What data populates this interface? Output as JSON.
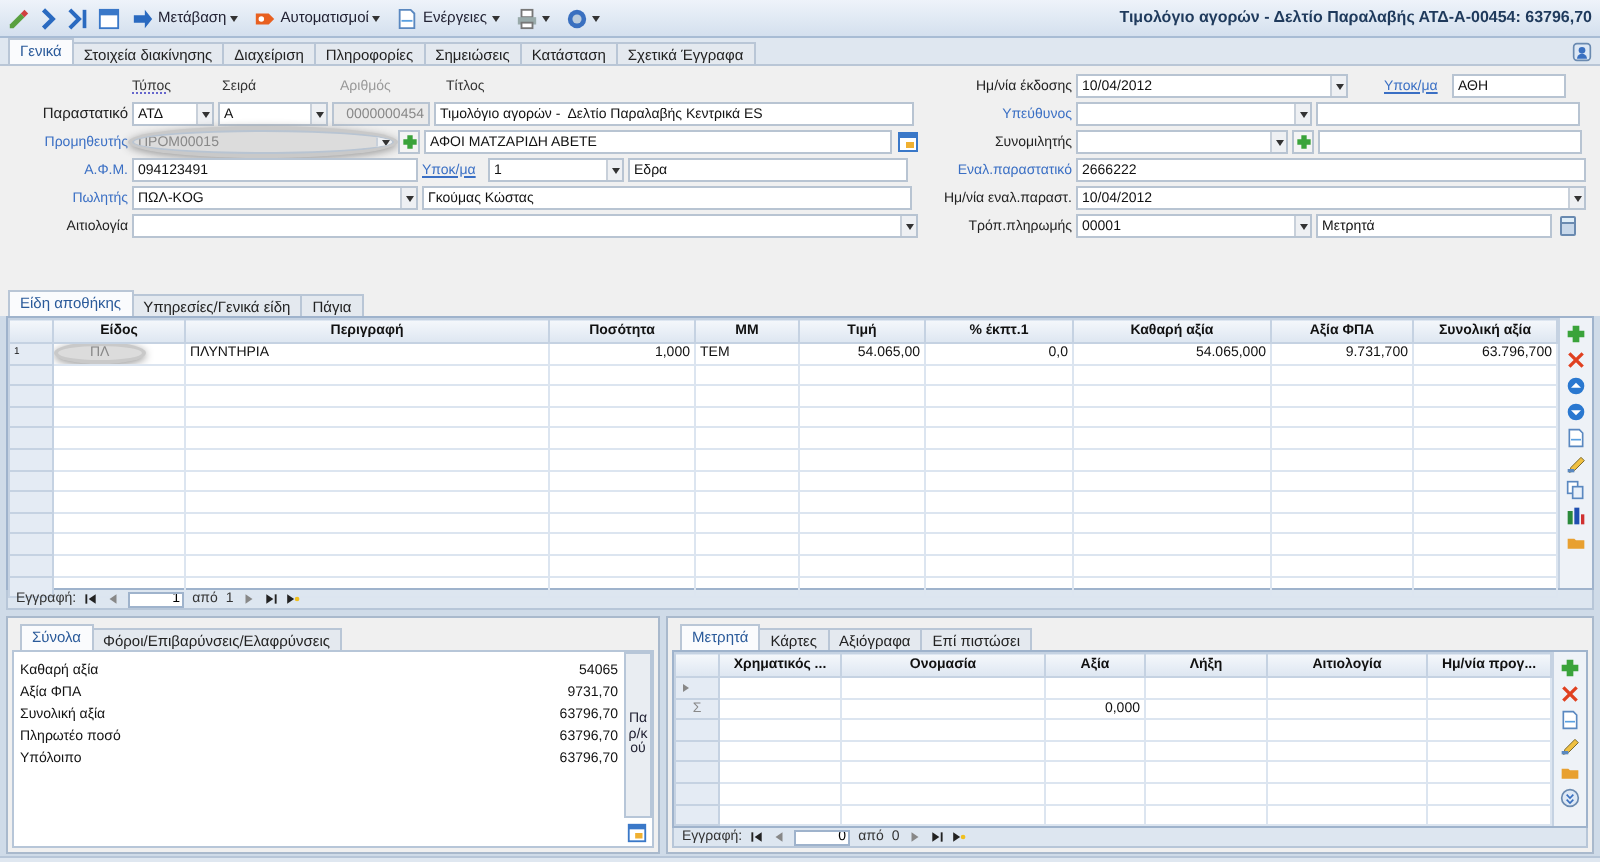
{
  "toolbar": {
    "menus": [
      {
        "label": "Μετάβαση"
      },
      {
        "label": "Αυτοματισμοί"
      },
      {
        "label": "Ενέργειες"
      }
    ],
    "title": "Τιμολόγιο αγορών -  Δελτίο Παραλαβής ΑΤΔ-Α-00454: 63796,70"
  },
  "tabs": [
    {
      "label": "Γενικά",
      "selected": true
    },
    {
      "label": "Στοιχεία διακίνησης",
      "selected": false
    },
    {
      "label": "Διαχείριση",
      "selected": false
    },
    {
      "label": "Πληροφορίες",
      "selected": false
    },
    {
      "label": "Σημειώσεις",
      "selected": false
    },
    {
      "label": "Κατάσταση",
      "selected": false
    },
    {
      "label": "Σχετικά Έγγραφα",
      "selected": false
    }
  ],
  "header_labels": [
    {
      "text": "Τύπος",
      "disabled": false
    },
    {
      "text": "Σειρά",
      "disabled": false
    },
    {
      "text": "Αριθμός",
      "disabled": true
    },
    {
      "text": "Τίτλος",
      "disabled": false
    }
  ],
  "left_rows": [
    {
      "label": "Παραστατικό",
      "link": false,
      "controls": [
        {
          "kind": "combo",
          "value": "ΑΤΔ"
        },
        {
          "kind": "combo",
          "value": "Α"
        },
        {
          "kind": "field",
          "value": "0000000454",
          "disabled": true
        },
        {
          "kind": "field",
          "value": "Τιμολόγιο αγορών -  Δελτίο Παραλαβής Κεντρικά ES"
        }
      ]
    },
    {
      "label": "Προμηθευτής",
      "link": true,
      "controls": [
        {
          "kind": "combo",
          "value": "ΠΡΟΜ00015",
          "highlighted": true
        },
        {
          "kind": "add"
        },
        {
          "kind": "field",
          "value": "ΑΦΟΙ ΜΑΤΖΑΡΙΔΗ ΑΒΕΤΕ"
        },
        {
          "kind": "calendar"
        }
      ]
    },
    {
      "label": "Α.Φ.Μ.",
      "link": true,
      "controls": [
        {
          "kind": "field",
          "value": "094123491"
        },
        {
          "kind": "link",
          "text": "Υποκ/μα"
        },
        {
          "kind": "combo",
          "value": "1"
        },
        {
          "kind": "field",
          "value": "Εδρα"
        }
      ]
    },
    {
      "label": "Πωλητής",
      "link": true,
      "controls": [
        {
          "kind": "combo",
          "value": "ΠΩΛ-KOG"
        },
        {
          "kind": "field",
          "value": "Γκούμας Κώστας"
        }
      ]
    },
    {
      "label": "Αιτιολογία",
      "link": false,
      "controls": [
        {
          "kind": "combo"
        }
      ]
    }
  ],
  "right_rows": [
    {
      "label": "Ημ/νία έκδοσης",
      "link": false,
      "controls": [
        {
          "kind": "combo",
          "value": "10/04/2012"
        },
        {
          "kind": "link",
          "text": "Υποκ/μα"
        },
        {
          "kind": "field",
          "value": "ΑΘΗ"
        }
      ]
    },
    {
      "label": "Υπεύθυνος",
      "link": true,
      "controls": [
        {
          "kind": "combo"
        },
        {
          "kind": "field"
        }
      ]
    },
    {
      "label": "Συνομιλητής",
      "link": false,
      "controls": [
        {
          "kind": "combo"
        },
        {
          "kind": "add"
        },
        {
          "kind": "field"
        }
      ]
    },
    {
      "label": "Εναλ.παραστατικό",
      "link": true,
      "controls": [
        {
          "kind": "field",
          "value": "2666222"
        }
      ]
    },
    {
      "label": "Ημ/νία εναλ.παραστ.",
      "link": false,
      "controls": [
        {
          "kind": "combo",
          "value": "10/04/2012"
        }
      ]
    },
    {
      "label": "Τρόπ.πληρωμής",
      "link": false,
      "controls": [
        {
          "kind": "combo",
          "value": "00001"
        },
        {
          "kind": "field",
          "value": "Μετρητά"
        },
        {
          "kind": "calculator"
        }
      ]
    }
  ],
  "item_tabs": [
    {
      "label": "Είδη αποθήκης",
      "selected": true
    },
    {
      "label": "Υπηρεσίες/Γενικά είδη",
      "selected": false
    },
    {
      "label": "Πάγια",
      "selected": false
    }
  ],
  "items_table": {
    "columns": [
      "Είδος",
      "Περιγραφή",
      "Ποσότητα",
      "ΜΜ",
      "Τιμή",
      "% έκπτ.1",
      "Καθαρή  αξία",
      "Αξία ΦΠΑ",
      "Συνολική αξία"
    ],
    "rows": [
      {
        "number": "1",
        "cells": [
          "ΠΛ",
          "ΠΛΥΝΤΗΡΙΑ",
          "1,000",
          "ΤΕΜ",
          "54.065,00",
          "0,0",
          "54.065,000",
          "9.731,700",
          "63.796,700"
        ],
        "highlighted": true
      }
    ]
  },
  "items_nav": {
    "label": "Εγγραφή:",
    "current": "1",
    "of": "από",
    "total": "1"
  },
  "totals_tabs": [
    {
      "label": "Σύνολα",
      "selected": true
    },
    {
      "label": "Φόροι/Επιβαρύνσεις/Ελαφρύνσεις",
      "selected": false
    }
  ],
  "totals": [
    {
      "label": "Καθαρή αξία",
      "value": "54065"
    },
    {
      "label": "Αξία ΦΠΑ",
      "value": "9731,70"
    },
    {
      "label": "Συνολική αξία",
      "value": "63796,70"
    },
    {
      "label": "Πληρωτέο ποσό",
      "value": "63796,70"
    },
    {
      "label": "Υπόλοιπο",
      "value": "63796,70"
    }
  ],
  "totals_side_button": "Παρ/κού",
  "payment_tabs": [
    {
      "label": "Μετρητά",
      "selected": true
    },
    {
      "label": "Κάρτες",
      "selected": false
    },
    {
      "label": "Αξιόγραφα",
      "selected": false
    },
    {
      "label": "Επί πιστώσει",
      "selected": false
    }
  ],
  "payment_table": {
    "columns": [
      "Χρηματικός ...",
      "Ονομασία",
      "Αξία",
      "Λήξη",
      "Αιτιολογία",
      "Ημ/νία προγ..."
    ],
    "sum_symbol": "Σ",
    "sum_cells": [
      "",
      "",
      "0,000",
      "",
      "",
      ""
    ]
  },
  "payment_nav": {
    "label": "Εγγραφή:",
    "current": "0",
    "of": "από",
    "total": "0"
  }
}
